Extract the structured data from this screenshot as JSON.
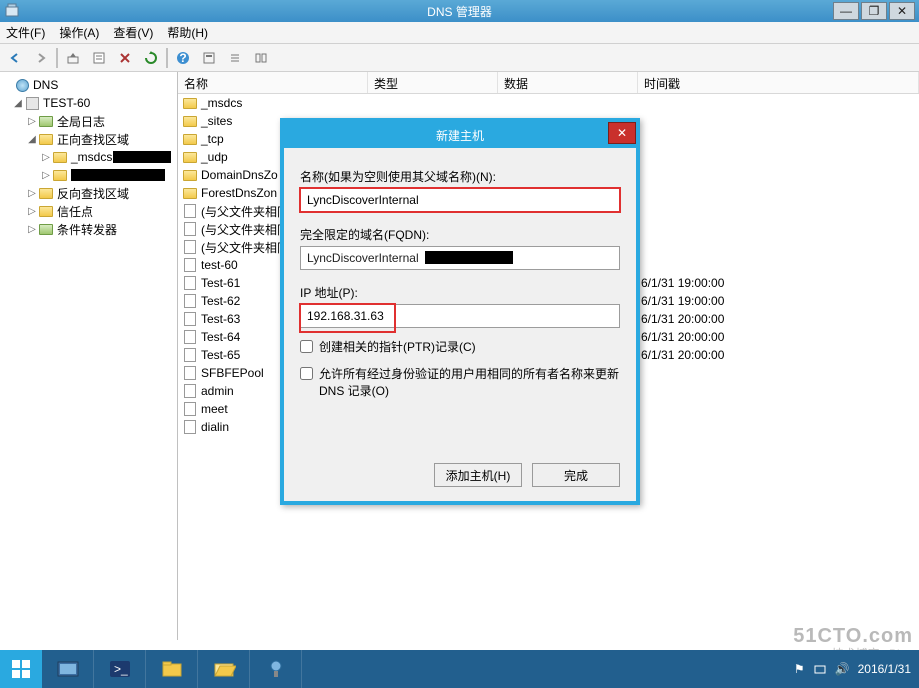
{
  "window": {
    "title": "DNS 管理器",
    "buttons": {
      "min": "—",
      "max": "❐",
      "close": "✕"
    }
  },
  "menu": {
    "file": "文件(F)",
    "action": "操作(A)",
    "view": "查看(V)",
    "help": "帮助(H)"
  },
  "tree": {
    "root": "DNS",
    "server": "TEST-60",
    "global_log": "全局日志",
    "fwd_zone": "正向查找区域",
    "msdcs": "_msdcs",
    "rev_zone": "反向查找区域",
    "trust": "信任点",
    "cond_fwd": "条件转发器"
  },
  "list": {
    "cols": {
      "name": "名称",
      "type": "类型",
      "data": "数据",
      "timestamp": "时间戳"
    },
    "items": [
      {
        "name": "_msdcs",
        "kind": "folder"
      },
      {
        "name": "_sites",
        "kind": "folder"
      },
      {
        "name": "_tcp",
        "kind": "folder"
      },
      {
        "name": "_udp",
        "kind": "folder"
      },
      {
        "name": "DomainDnsZo",
        "kind": "folder"
      },
      {
        "name": "ForestDnsZon",
        "kind": "folder"
      },
      {
        "name": "(与父文件夹相同",
        "kind": "page"
      },
      {
        "name": "(与父文件夹相同",
        "kind": "page"
      },
      {
        "name": "(与父文件夹相同",
        "kind": "page"
      },
      {
        "name": "test-60",
        "kind": "page"
      },
      {
        "name": "Test-61",
        "kind": "page",
        "ts": "6/1/31 19:00:00"
      },
      {
        "name": "Test-62",
        "kind": "page",
        "ts": "6/1/31 19:00:00"
      },
      {
        "name": "Test-63",
        "kind": "page",
        "ts": "6/1/31 20:00:00"
      },
      {
        "name": "Test-64",
        "kind": "page",
        "ts": "6/1/31 20:00:00"
      },
      {
        "name": "Test-65",
        "kind": "page",
        "ts": "6/1/31 20:00:00"
      },
      {
        "name": "SFBFEPool",
        "kind": "page"
      },
      {
        "name": "admin",
        "kind": "page"
      },
      {
        "name": "meet",
        "kind": "page"
      },
      {
        "name": "dialin",
        "kind": "page"
      }
    ]
  },
  "dialog": {
    "title": "新建主机",
    "name_label": "名称(如果为空则使用其父域名称)(N):",
    "name_value": "LyncDiscoverInternal",
    "fqdn_label": "完全限定的域名(FQDN):",
    "fqdn_value": "LyncDiscoverInternal",
    "ip_label": "IP 地址(P):",
    "ip_value": "192.168.31.63",
    "ptr_label": "创建相关的指针(PTR)记录(C)",
    "allow_label": "允许所有经过身份验证的用户用相同的所有者名称来更新 DNS 记录(O)",
    "add_btn": "添加主机(H)",
    "done_btn": "完成"
  },
  "taskbar": {
    "date": "2016/1/31"
  },
  "watermark": {
    "big": "51CTO.com",
    "small": "技术博客 zBlog"
  }
}
